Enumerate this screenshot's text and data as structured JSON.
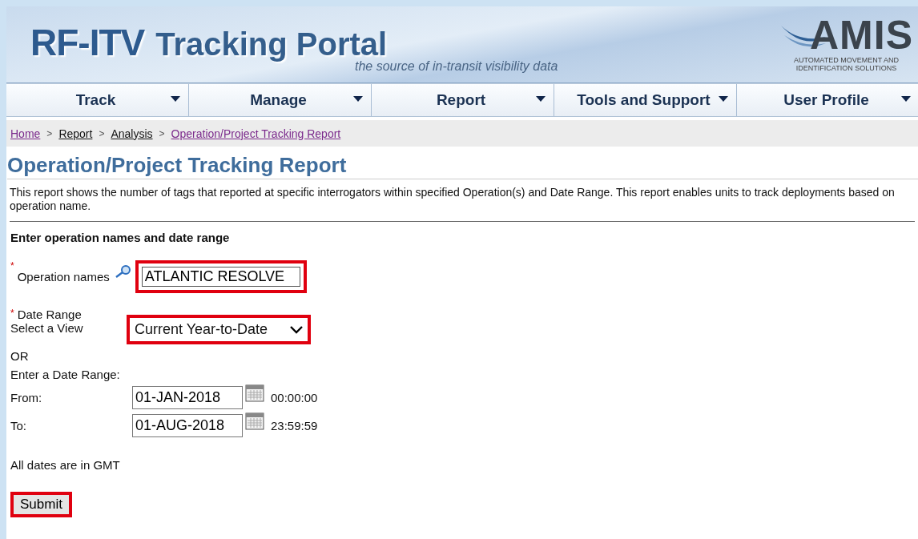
{
  "header": {
    "title_part_1": "RF-ITV",
    "title_part_2": "Tracking Portal",
    "tagline": "the source of in-transit visibility data",
    "logo": {
      "name": "AMIS",
      "subtitle_line_1": "AUTOMATED MOVEMENT AND",
      "subtitle_line_2": "IDENTIFICATION SOLUTIONS"
    }
  },
  "nav": [
    {
      "label": "Track"
    },
    {
      "label": "Manage"
    },
    {
      "label": "Report"
    },
    {
      "label": "Tools and Support"
    },
    {
      "label": "User Profile"
    }
  ],
  "breadcrumb": [
    {
      "label": "Home",
      "visited": true
    },
    {
      "label": "Report",
      "visited": false
    },
    {
      "label": "Analysis",
      "visited": false
    },
    {
      "label": "Operation/Project Tracking Report",
      "visited": true
    }
  ],
  "breadcrumb_separator": ">",
  "page_title": "Operation/Project Tracking Report",
  "description": "This report shows the number of tags that reported at specific interrogators within specified Operation(s) and Date Range. This report enables units to track deployments based on operation name.",
  "form": {
    "heading": "Enter operation names and date range",
    "required_mark": "*",
    "operation_label": "Operation names",
    "operation_value": "ATLANTIC RESOLVE",
    "operation_highlighted": true,
    "date_range_label": "Date Range",
    "view_label": "Select a View",
    "view_value": "Current Year-to-Date",
    "view_highlighted": true,
    "or_text": "OR",
    "enter_range_label": "Enter a Date Range:",
    "from_label": "From:",
    "from_value": "01-JAN-2018",
    "from_time": "00:00:00",
    "to_label": "To:",
    "to_value": "01-AUG-2018",
    "to_time": "23:59:59",
    "timezone_note": "All dates are in GMT",
    "submit_label": "Submit",
    "submit_highlighted": true
  }
}
